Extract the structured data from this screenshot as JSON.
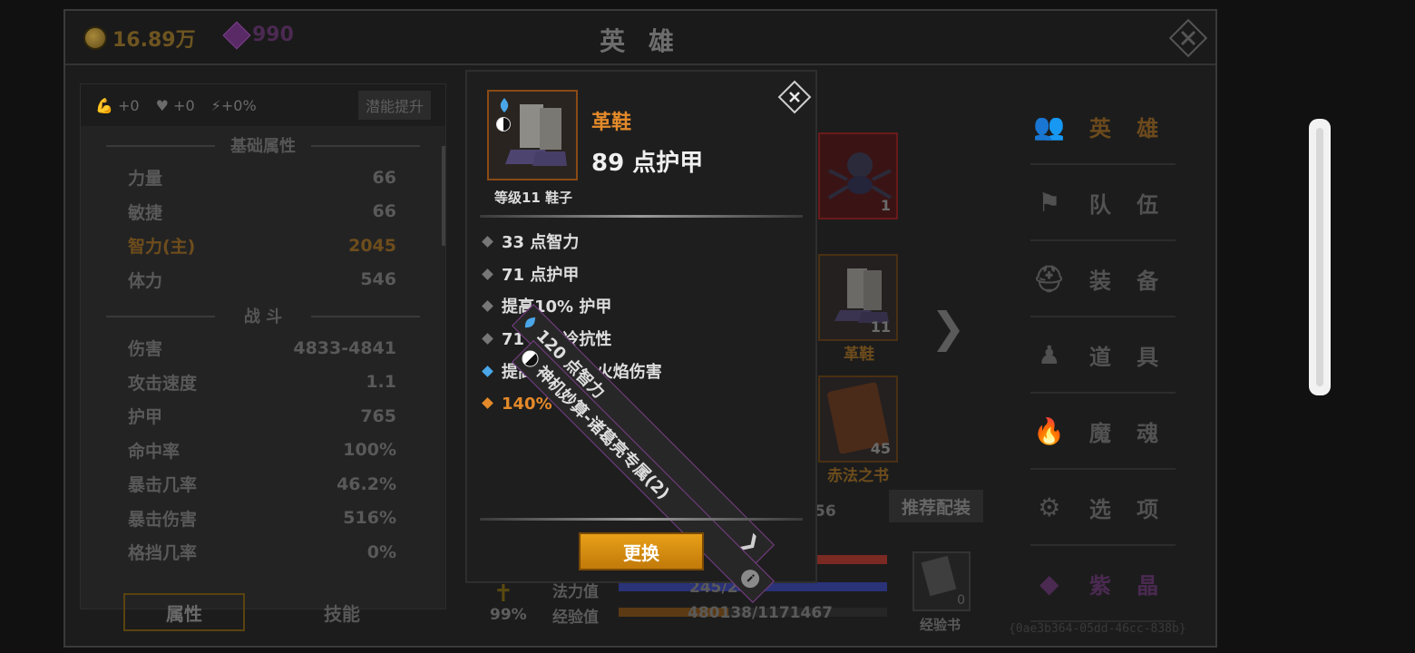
{
  "header": {
    "gold": "16.89万",
    "gems": "990",
    "title": "英 雄"
  },
  "left_panel": {
    "bonuses": [
      "+0",
      "+0",
      "+0%"
    ],
    "potential_button": "潜能提升",
    "base_section": "基础属性",
    "base_stats": [
      {
        "label": "力量",
        "value": "66"
      },
      {
        "label": "敏捷",
        "value": "66"
      },
      {
        "label": "智力(主)",
        "value": "2045"
      },
      {
        "label": "体力",
        "value": "546"
      }
    ],
    "combat_section": "战 斗",
    "combat_stats": [
      {
        "label": "伤害",
        "value": "4833-4841"
      },
      {
        "label": "攻击速度",
        "value": "1.1"
      },
      {
        "label": "护甲",
        "value": "765"
      },
      {
        "label": "命中率",
        "value": "100%"
      },
      {
        "label": "暴击几率",
        "value": "46.2%"
      },
      {
        "label": "暴击伤害",
        "value": "516%"
      },
      {
        "label": "格挡几率",
        "value": "0%"
      }
    ],
    "tabs": [
      "属性",
      "技能"
    ]
  },
  "center": {
    "slot_top_count": "1",
    "boots_count": "11",
    "boots_label": "革鞋",
    "book_count": "45",
    "book_label": "赤法之书",
    "partial_number": "56",
    "recommend_button": "推荐配装",
    "mana_label": "法力值",
    "mana_value": "245/245",
    "mana_fraction": 1.0,
    "exp_label": "经验值",
    "exp_value": "480138/1171467",
    "exp_fraction": 0.41,
    "level_percent": "99%",
    "exp_book_label": "经验书",
    "exp_book_count": "0"
  },
  "right_menu": [
    {
      "label": "英 雄",
      "icon": "hero-icon"
    },
    {
      "label": "队 伍",
      "icon": "flag-icon"
    },
    {
      "label": "装 备",
      "icon": "helmet-icon"
    },
    {
      "label": "道 具",
      "icon": "bag-icon"
    },
    {
      "label": "魔 魂",
      "icon": "flame-icon"
    },
    {
      "label": "选 项",
      "icon": "gear-icon"
    },
    {
      "label": "紫 晶",
      "icon": "crystal-icon"
    }
  ],
  "uuid": "{0ae3b364-05dd-46cc-838b}",
  "popup": {
    "item_name": "革鞋",
    "item_armor": "89 点护甲",
    "item_level": "等级11 鞋子",
    "affixes": [
      {
        "text": "33 点智力",
        "kind": "normal"
      },
      {
        "text": "71 点护甲",
        "kind": "normal"
      },
      {
        "text": "提高10% 护甲",
        "kind": "normal"
      },
      {
        "text": "71 点冰冷抗性",
        "kind": "normal"
      },
      {
        "text": "提高11.1% 火焰伤害",
        "kind": "blue"
      },
      {
        "text": "140% 暴击伤害",
        "kind": "orange"
      }
    ],
    "gem_affix": "120 点智力",
    "set_affix": "神机妙算-诸葛亮专属(2)",
    "swap_button": "更换"
  },
  "colors": {
    "accent_orange": "#e48a2a",
    "blue_affix": "#4aa6e8",
    "button_gold": "#e8a018"
  }
}
